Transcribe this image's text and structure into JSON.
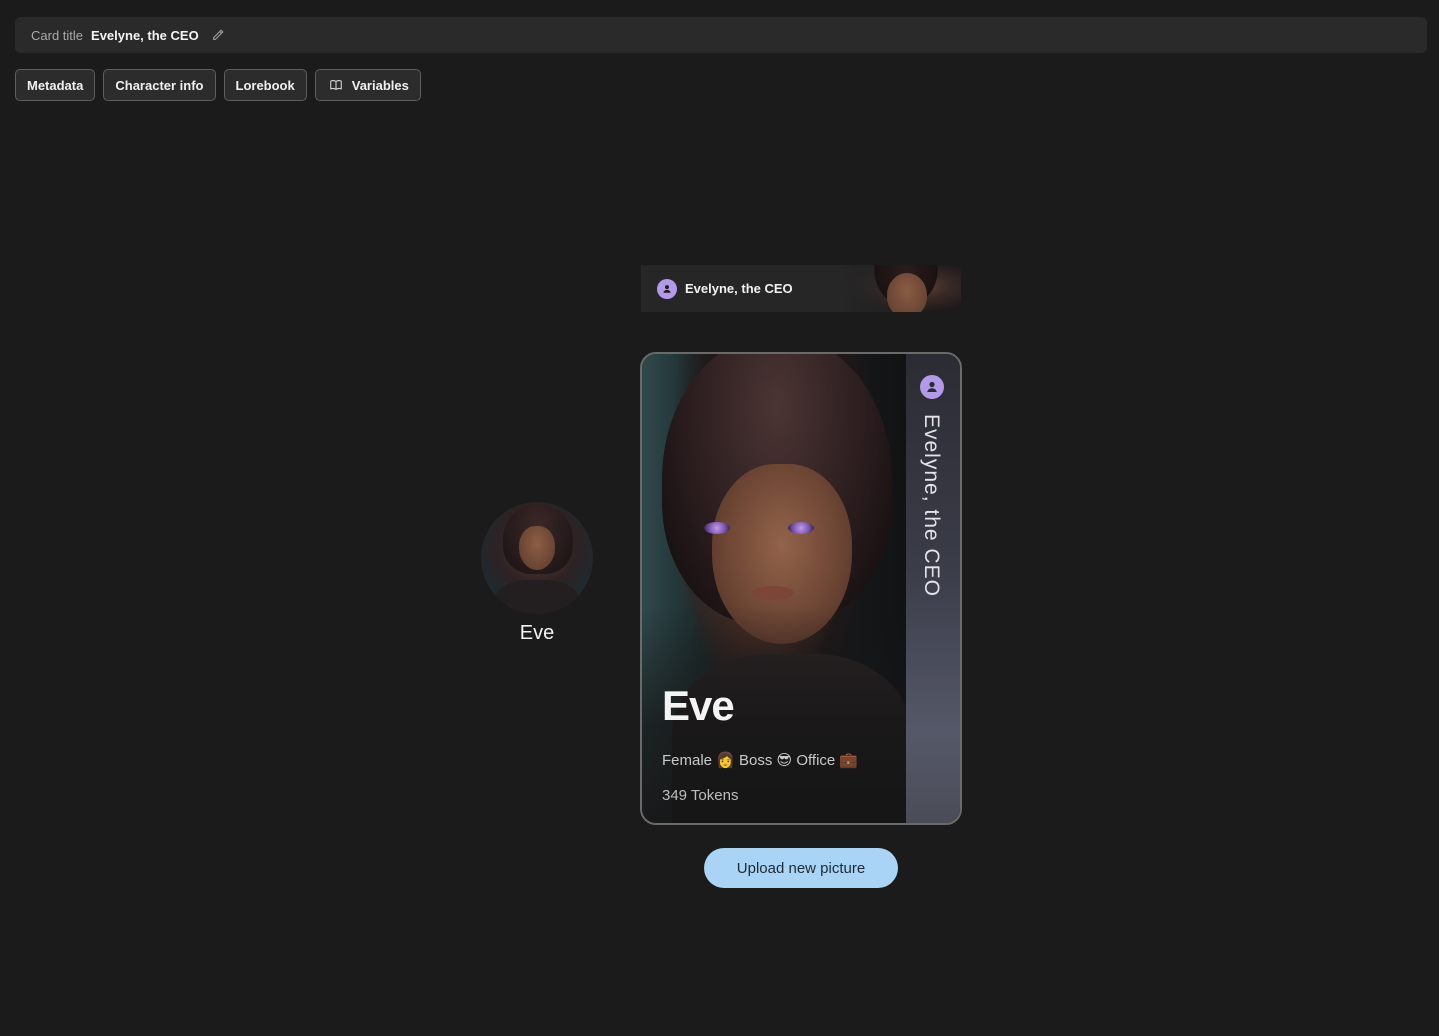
{
  "header": {
    "card_title_label": "Card title",
    "card_title_value": "Evelyne, the CEO"
  },
  "tabs": [
    {
      "label": "Metadata"
    },
    {
      "label": "Character info"
    },
    {
      "label": "Lorebook"
    },
    {
      "label": "Variables",
      "icon": "book-open-icon"
    }
  ],
  "strip": {
    "name": "Evelyne, the CEO",
    "icon": "user-icon"
  },
  "avatar": {
    "name": "Eve"
  },
  "card": {
    "side_title": "Evelyne, the CEO",
    "name": "Eve",
    "tags": "Female 👩 Boss 😎 Office 💼",
    "tokens": "349 Tokens"
  },
  "actions": {
    "upload_label": "Upload new picture"
  },
  "colors": {
    "accent_badge": "#b39ae8",
    "upload_button": "#a9d4f5",
    "background": "#1b1b1b"
  }
}
